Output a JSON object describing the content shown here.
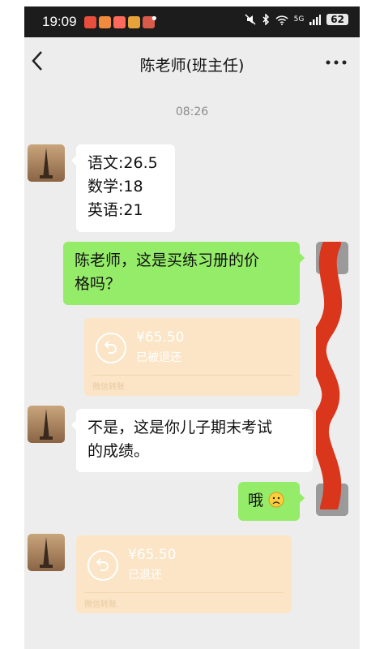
{
  "status_bar": {
    "time": "19:09",
    "battery": "62",
    "network": "5G",
    "more": "•"
  },
  "header": {
    "title": "陈老师(班主任)",
    "back_icon": "chevron-left-icon",
    "more_icon": "more-horizontal-icon"
  },
  "time_divider": "08:26",
  "messages": [
    {
      "from": "teacher",
      "type": "text",
      "lines": [
        "语文:26.5",
        "数学:18",
        "英语:21"
      ]
    },
    {
      "from": "me",
      "type": "text",
      "lines": [
        "陈老师，这是买练习册的价",
        "格吗？"
      ]
    },
    {
      "from": "me",
      "type": "transfer",
      "amount": "¥65.50",
      "status": "已被退还",
      "footer": "微信转账"
    },
    {
      "from": "teacher",
      "type": "text",
      "lines": [
        "不是，这是你儿子期末考试",
        "的成绩。"
      ]
    },
    {
      "from": "me",
      "type": "text",
      "lines": [
        "哦"
      ],
      "emoji": "sad-face-icon"
    },
    {
      "from": "teacher",
      "type": "transfer",
      "amount": "¥65.50",
      "status": "已退还",
      "footer": "微信转账"
    }
  ],
  "colors": {
    "chat_bg": "#ededed",
    "green_bubble": "#95ec69",
    "white_bubble": "#ffffff",
    "transfer_bg": "#fbe5c6",
    "redaction": "#d9361c"
  }
}
